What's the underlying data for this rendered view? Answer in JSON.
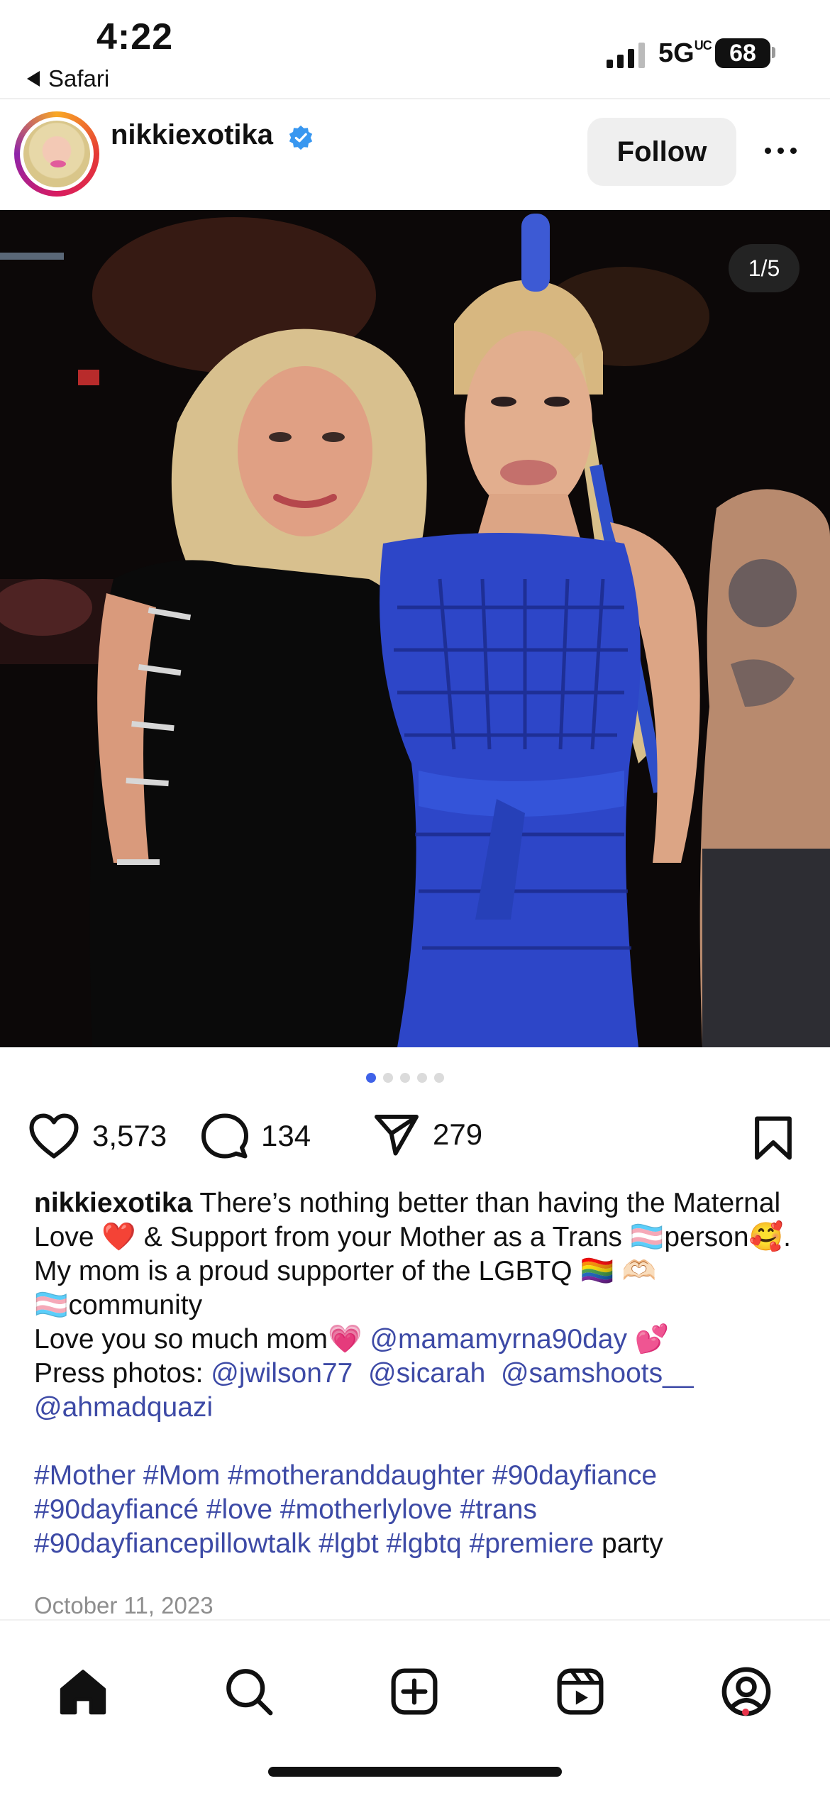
{
  "status_bar": {
    "time": "4:22",
    "back_app": "Safari",
    "network": "5G",
    "network_suffix": "UC",
    "battery": "68"
  },
  "post_header": {
    "username": "nikkiexotika",
    "verified": true,
    "follow_label": "Follow"
  },
  "media": {
    "page_counter": "1/5",
    "total_pages": 5,
    "current_page": 1
  },
  "actions": {
    "likes": "3,573",
    "comments": "134",
    "shares": "279"
  },
  "caption": {
    "username": "nikkiexotika",
    "line1_text": " There’s nothing better than having the Maternal Love ❤️ & Support from your Mother as a Trans 🏳️‍⚧️person🥰. My mom is a proud supporter of the LGBTQ 🏳️‍🌈 🫶🏻 🏳️‍⚧️community",
    "line2_text": "Love you so much mom💗 ",
    "line2_mention": "@mamamyrna90day",
    "line2_emoji": " 💕",
    "press_label": "Press photos: ",
    "press_mentions": [
      "@jwilson77",
      "@sicarah",
      "@samshoots__",
      "@ahmadquazi"
    ],
    "hashtags": "#Mother #Mom #motheranddaughter #90dayfiance #90dayfiancé #love #motherlylove #trans #90dayfiancepillowtalk #lgbt #lgbtq #premiere",
    "trailing_text": " party"
  },
  "date": "October 11, 2023",
  "bottom_nav": {
    "items": [
      "home-icon",
      "search-icon",
      "create-icon",
      "reels-icon",
      "profile-icon"
    ],
    "active": "home-icon"
  },
  "colors": {
    "link": "#3d4aa6",
    "active_dot": "#3f62e8",
    "notification_dot": "#e8334a"
  }
}
